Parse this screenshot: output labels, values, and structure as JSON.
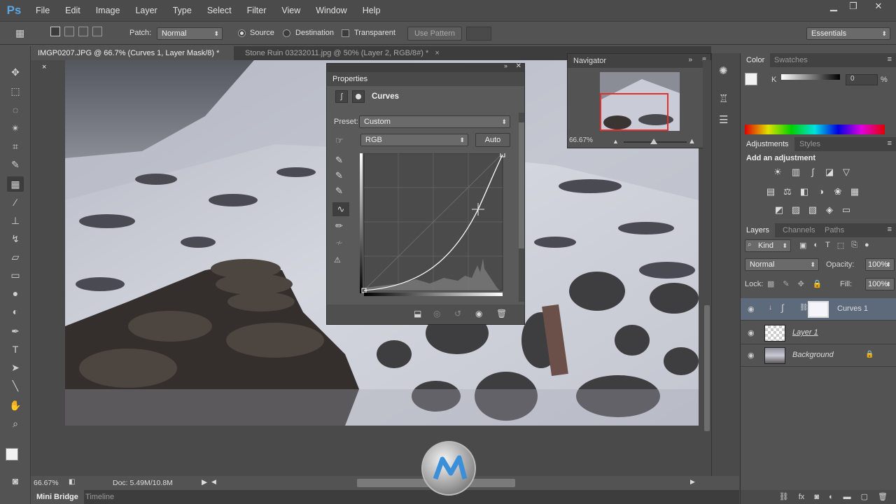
{
  "app": {
    "logo": "Ps"
  },
  "menu": [
    "File",
    "Edit",
    "Image",
    "Layer",
    "Type",
    "Select",
    "Filter",
    "View",
    "Window",
    "Help"
  ],
  "window_controls": {
    "minimize": "▁",
    "restore": "❐",
    "close": "✕"
  },
  "options": {
    "patch_label": "Patch:",
    "patch_mode": "Normal",
    "source_label": "Source",
    "destination_label": "Destination",
    "transparent_label": "Transparent",
    "use_pattern_label": "Use Pattern",
    "workspace": "Essentials"
  },
  "tabs": [
    {
      "title": "IMGP0207.JPG @ 66.7% (Curves 1, Layer Mask/8) *",
      "close": "×"
    },
    {
      "title": "Stone Ruin 03232011.jpg @ 50% (Layer 2, RGB/8#) *",
      "close": "×"
    }
  ],
  "properties": {
    "title": "Properties",
    "section": "Curves",
    "preset_label": "Preset:",
    "preset_value": "Custom",
    "channel": "RGB",
    "auto_label": "Auto"
  },
  "navigator": {
    "title": "Navigator",
    "zoom": "66.67%"
  },
  "color": {
    "tab_color": "Color",
    "tab_swatches": "Swatches",
    "channel_label": "K",
    "value": "0",
    "unit": "%"
  },
  "adjustments": {
    "tab_adjustments": "Adjustments",
    "tab_styles": "Styles",
    "heading": "Add an adjustment"
  },
  "layers": {
    "tab_layers": "Layers",
    "tab_channels": "Channels",
    "tab_paths": "Paths",
    "kind_label": "Kind",
    "blend_mode": "Normal",
    "opacity_label": "Opacity:",
    "opacity": "100%",
    "lock_label": "Lock:",
    "fill_label": "Fill:",
    "fill": "100%",
    "items": [
      {
        "name": "Curves 1"
      },
      {
        "name": "Layer 1"
      },
      {
        "name": "Background"
      }
    ]
  },
  "status": {
    "zoom": "66.67%",
    "doc": "Doc: 5.49M/10.8M"
  },
  "bottom_tabs": [
    "Mini Bridge",
    "Timeline"
  ],
  "colors": {
    "accent": "#5aa7e6",
    "selected_layer": "#5c6a7c",
    "navigator_box": "#e03030"
  }
}
